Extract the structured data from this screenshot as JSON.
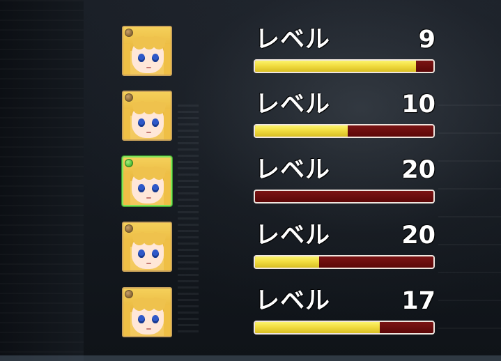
{
  "background": {
    "theme": "dark-alley"
  },
  "rows": [
    {
      "avatar_icon": "character-portrait-icon",
      "orb_color": "#8e6a37",
      "avatar_border": "#c9a25a",
      "label": "レベル",
      "level": "9",
      "exp_fraction": 0.903
    },
    {
      "avatar_icon": "character-portrait-icon",
      "orb_color": "#8e6a37",
      "avatar_border": "#c9a25a",
      "label": "レベル",
      "level": "10",
      "exp_fraction": 0.52
    },
    {
      "avatar_icon": "character-portrait-icon",
      "orb_color": "#58c43e",
      "avatar_border": "#7fe25a",
      "label": "レベル",
      "level": "20",
      "exp_fraction": 0.0
    },
    {
      "avatar_icon": "character-portrait-icon",
      "orb_color": "#8e6a37",
      "avatar_border": "#c9a25a",
      "label": "レベル",
      "level": "20",
      "exp_fraction": 0.36
    },
    {
      "avatar_icon": "character-portrait-icon",
      "orb_color": "#8e6a37",
      "avatar_border": "#c9a25a",
      "label": "レベル",
      "level": "17",
      "exp_fraction": 0.7
    }
  ]
}
